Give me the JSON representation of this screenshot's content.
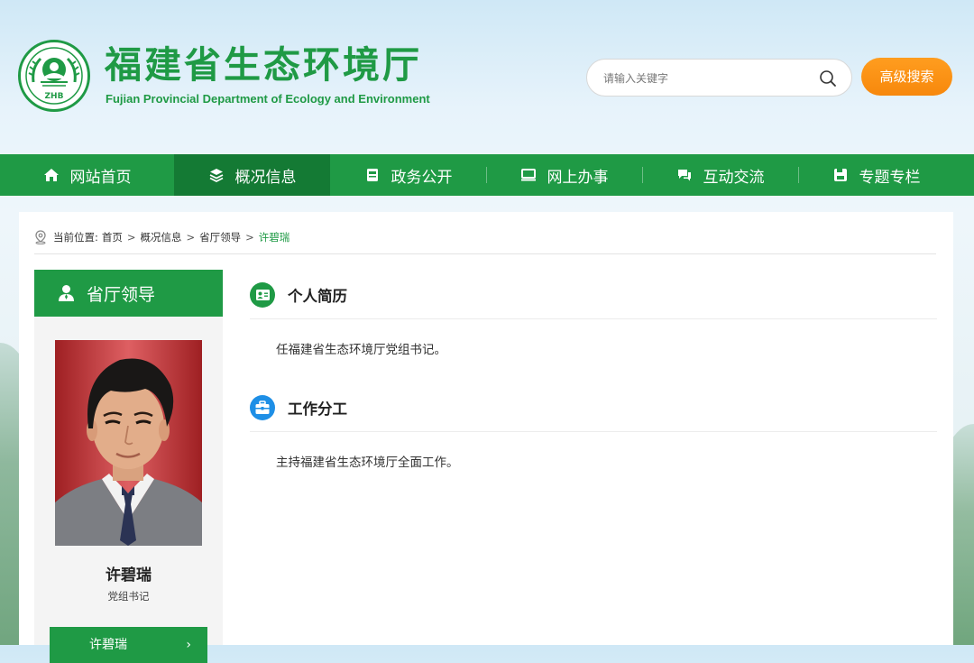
{
  "header": {
    "title": "福建省生态环境厅",
    "subtitle": "Fujian Provincial Department of Ecology and Environment",
    "logo_text": "ZHB",
    "search_placeholder": "请输入关键字",
    "advanced_search_label": "高级搜索"
  },
  "nav": {
    "items": [
      {
        "label": "网站首页",
        "icon": "home-icon"
      },
      {
        "label": "概况信息",
        "icon": "layers-icon",
        "active": true
      },
      {
        "label": "政务公开",
        "icon": "document-icon"
      },
      {
        "label": "网上办事",
        "icon": "monitor-icon"
      },
      {
        "label": "互动交流",
        "icon": "chat-icon"
      },
      {
        "label": "专题专栏",
        "icon": "save-icon"
      }
    ]
  },
  "breadcrumb": {
    "prefix": "当前位置:",
    "items": [
      "首页",
      "概况信息",
      "省厅领导"
    ],
    "current": "许碧瑞",
    "separator": ">"
  },
  "sidebar": {
    "header": "省厅领导",
    "person_name": "许碧瑞",
    "person_title": "党组书记",
    "button_label": "许碧瑞",
    "button_arrow": "›"
  },
  "main": {
    "sections": [
      {
        "title": "个人简历",
        "text": "任福建省生态环境厅党组书记。",
        "icon": "resume-icon",
        "icon_color": "#1f9a45"
      },
      {
        "title": "工作分工",
        "text": "主持福建省生态环境厅全面工作。",
        "icon": "briefcase-icon",
        "icon_color": "#1e8fe6"
      }
    ]
  },
  "colors": {
    "brand_green": "#1f9a45",
    "nav_active": "#147a34",
    "accent_orange": "#f7880c",
    "accent_blue": "#1e8fe6"
  }
}
